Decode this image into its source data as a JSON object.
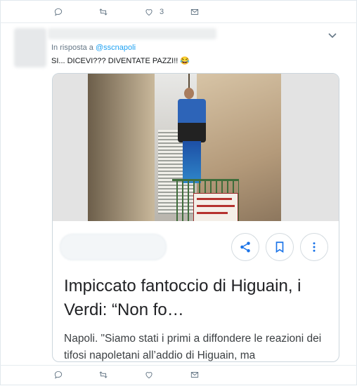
{
  "top_actions": {
    "reply_count": "",
    "retweet_count": "",
    "like_count": "3",
    "dm_count": ""
  },
  "tweet": {
    "reply_prefix": "In risposta a",
    "reply_handle": "@sscnapoli",
    "text": "SI... DICEVI??? DIVENTATE PAZZI!! 😂"
  },
  "card": {
    "headline": "Impiccato fantoccio di Higuain, i Verdi: “Non fo…",
    "snippet": "Napoli. \"Siamo stati i primi a diffondere le reazioni dei tifosi napoletani all’addio di Higuain, ma",
    "banner_text": "NON SEI STATO ALL'ALTEZZA ESULTNA",
    "icons": {
      "share": "share-icon",
      "bookmark": "bookmark-icon",
      "more": "more-vertical-icon"
    }
  },
  "colors": {
    "link": "#1da1f2",
    "icon_blue": "#1a73e8",
    "muted": "#657786"
  }
}
